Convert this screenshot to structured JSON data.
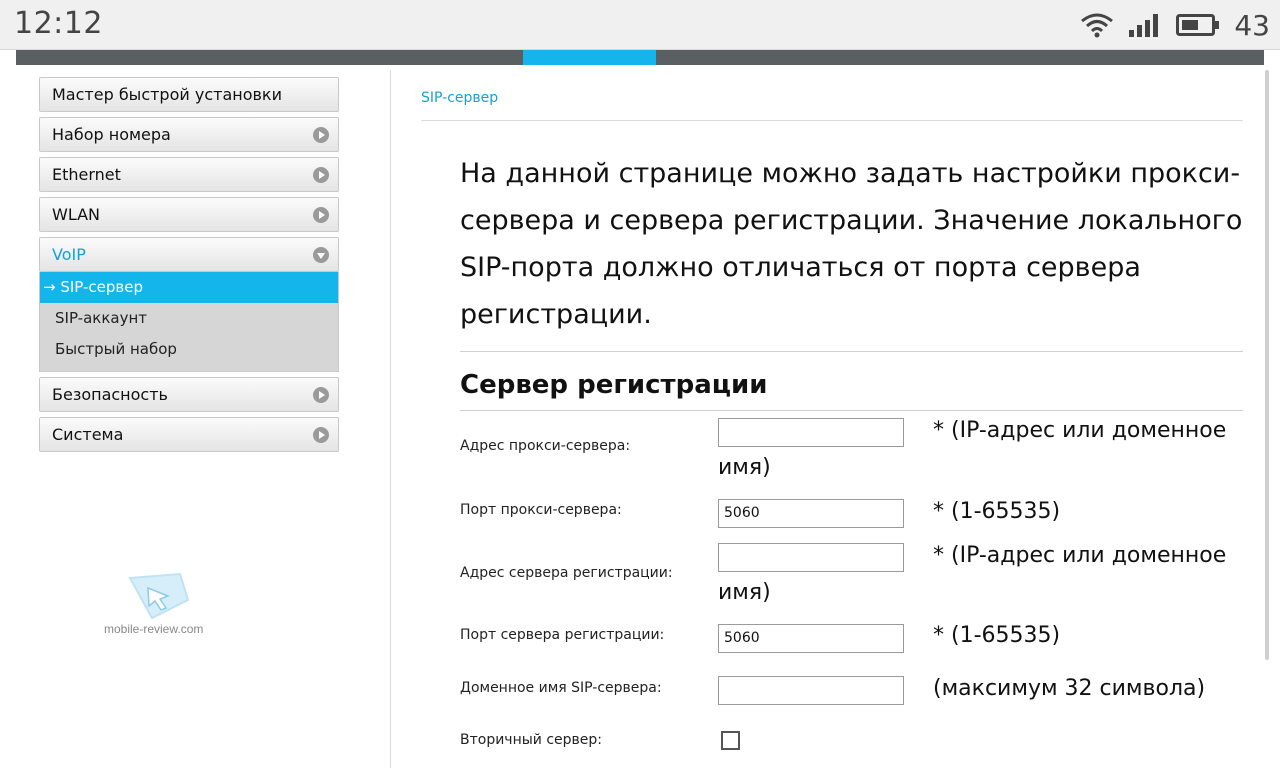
{
  "statusbar": {
    "time": "12:12",
    "battery": "43"
  },
  "sidebar": {
    "items": [
      {
        "label": "Мастер быстрой установки"
      },
      {
        "label": "Набор номера"
      },
      {
        "label": "Ethernet"
      },
      {
        "label": "WLAN"
      },
      {
        "label": "VoIP"
      },
      {
        "label": "Безопасность"
      },
      {
        "label": "Система"
      }
    ],
    "voip_sub": [
      {
        "label": "→ SIP-сервер"
      },
      {
        "label": "SIP-аккаунт"
      },
      {
        "label": "Быстрый набор"
      }
    ]
  },
  "watermark": {
    "text": "mobile-review.com"
  },
  "main": {
    "breadcrumb": "SIP-сервер",
    "description": "На данной странице можно задать настройки прокси-сервера и сервера регистрации. Значение локального SIP-порта должно отличаться от порта сервера регистрации.",
    "section_title": "Сервер регистрации",
    "fields": [
      {
        "label": "Адрес прокси-сервера:",
        "value": "",
        "hint": "* (IP-адрес или доменное имя)"
      },
      {
        "label": "Порт прокси-сервера:",
        "value": "5060",
        "hint": "* (1-65535)"
      },
      {
        "label": "Адрес сервера регистрации:",
        "value": "",
        "hint": "* (IP-адрес или доменное имя)"
      },
      {
        "label": "Порт сервера регистрации:",
        "value": "5060",
        "hint": "* (1-65535)"
      },
      {
        "label": "Доменное имя SIP-сервера:",
        "value": "",
        "hint": "(максимум 32 символа)"
      },
      {
        "label": "Вторичный сервер:"
      }
    ]
  },
  "colors": {
    "accent": "#13b5ea",
    "link": "#13a2d4"
  }
}
